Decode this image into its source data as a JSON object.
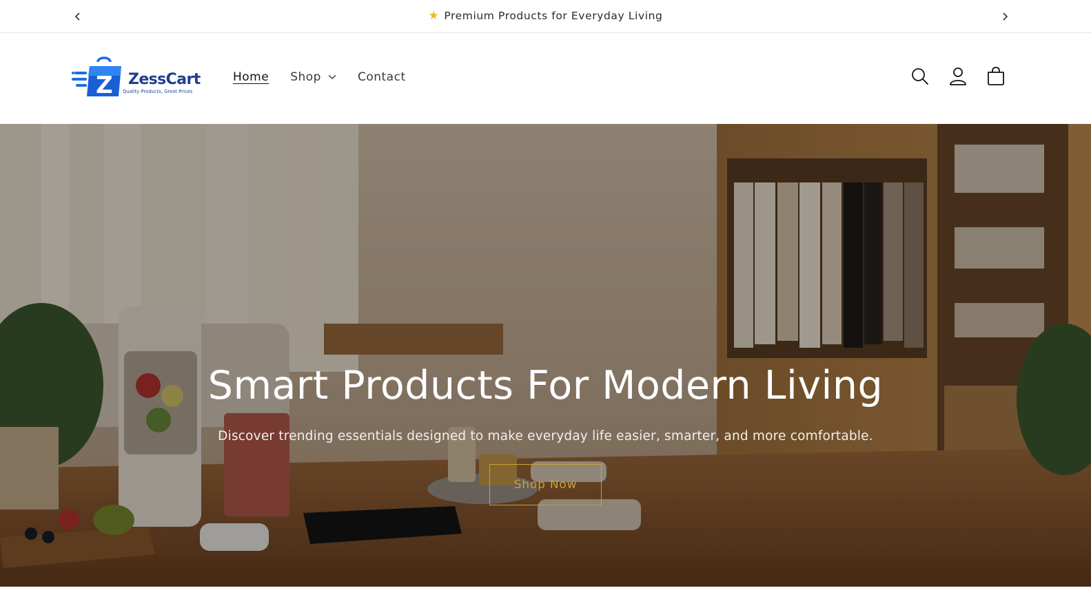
{
  "announcement": {
    "message": "Premium Products for Everyday Living",
    "prev_icon": "chevron-left-icon",
    "next_icon": "chevron-right-icon",
    "star_color": "#f2b51c"
  },
  "logo": {
    "name": "ZessCart",
    "tagline": "Quality Products, Great Prices",
    "brand_color": "#1f3f8f"
  },
  "nav": {
    "items": [
      {
        "label": "Home",
        "active": true
      },
      {
        "label": "Shop",
        "has_dropdown": true
      },
      {
        "label": "Contact"
      }
    ]
  },
  "header_icons": [
    "search-icon",
    "account-icon",
    "cart-icon"
  ],
  "hero": {
    "title": "Smart Products For Modern Living",
    "subtitle": "Discover trending essentials designed to make everyday life easier, smarter, and more comfortable.",
    "cta_label": "Shop Now",
    "cta_color": "#c9a03a"
  }
}
